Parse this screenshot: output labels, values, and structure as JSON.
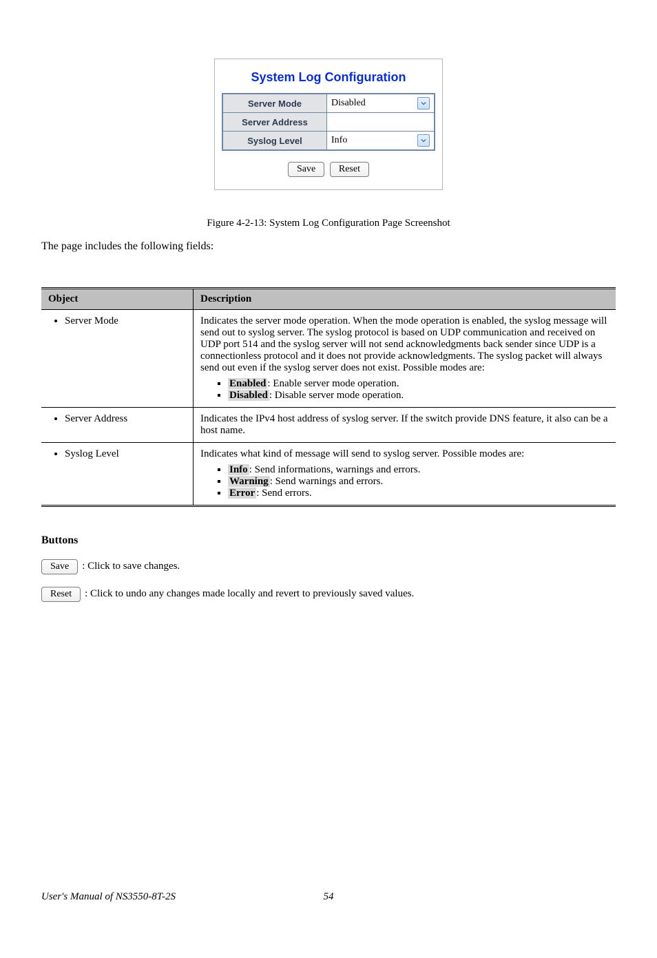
{
  "figure": {
    "title": "System Log Configuration",
    "rows": {
      "server_mode": {
        "label": "Server Mode",
        "value": "Disabled",
        "type": "select"
      },
      "server_address": {
        "label": "Server Address",
        "value": "",
        "type": "text"
      },
      "syslog_level": {
        "label": "Syslog Level",
        "value": "Info",
        "type": "select"
      }
    },
    "save": "Save",
    "reset": "Reset",
    "caption": "Figure 4-2-13: System Log Configuration Page Screenshot"
  },
  "intro": "The page includes the following fields:",
  "table": {
    "head": {
      "obj": "Object",
      "desc": "Description"
    },
    "rows": [
      {
        "obj": "Server Mode",
        "desc_pre": "Indicates the server mode operation. When the mode operation is enabled, the syslog message will send out to syslog server. The syslog protocol is based on UDP communication and received on UDP port 514 and the syslog server will not send acknowledgments back sender since UDP is a connectionless protocol and it does not provide acknowledgments. The syslog packet will always send out even if the syslog server does not exist. Possible modes are:",
        "bullets": [
          {
            "hl": "Enabled",
            "txt": ": Enable server mode operation."
          },
          {
            "hl": "Disabled",
            "txt": ": Disable server mode operation."
          }
        ]
      },
      {
        "obj": "Server Address",
        "desc_pre": "Indicates the IPv4 host address of syslog server. If the switch provide DNS feature, it also can be a host name.",
        "bullets": []
      },
      {
        "obj": "Syslog Level",
        "desc_pre": "Indicates what kind of message will send to syslog server. Possible modes are:",
        "bullets": [
          {
            "hl": "Info",
            "txt": ": Send informations, warnings and errors."
          },
          {
            "hl": "Warning",
            "txt": ": Send warnings and errors."
          },
          {
            "hl": "Error",
            "txt": ": Send errors."
          }
        ]
      }
    ]
  },
  "buttons_heading": "Buttons",
  "buttons": [
    {
      "label": "Save",
      "desc": ": Click to save changes."
    },
    {
      "label": "Reset",
      "desc": ": Click to undo any changes made locally and revert to previously saved values."
    }
  ],
  "footer": {
    "left": "User's Manual of NS3550-8T-2S",
    "page": "54"
  }
}
